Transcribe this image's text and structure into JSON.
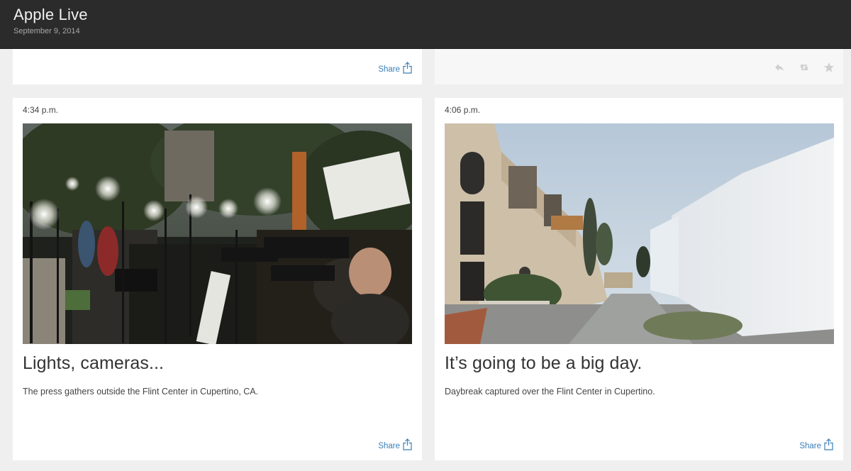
{
  "header": {
    "title": "Apple Live",
    "date": "September 9, 2014"
  },
  "top_cards": {
    "left": {
      "share_label": "Share"
    },
    "right": {
      "actions": [
        "reply-icon",
        "retweet-icon",
        "favorite-icon"
      ]
    }
  },
  "posts": [
    {
      "time": "4:34 p.m.",
      "headline": "Lights, cameras...",
      "caption": "The press gathers outside the Flint Center in Cupertino, CA.",
      "image": "press-cameras-photo",
      "share_label": "Share"
    },
    {
      "time": "4:06 p.m.",
      "headline": "It’s going to be a big day.",
      "caption": "Daybreak captured over the Flint Center in Cupertino.",
      "image": "flint-center-daybreak-photo",
      "share_label": "Share"
    }
  ],
  "colors": {
    "header_bg": "#2b2b2b",
    "page_bg": "#efefef",
    "link": "#3a7fb8"
  }
}
